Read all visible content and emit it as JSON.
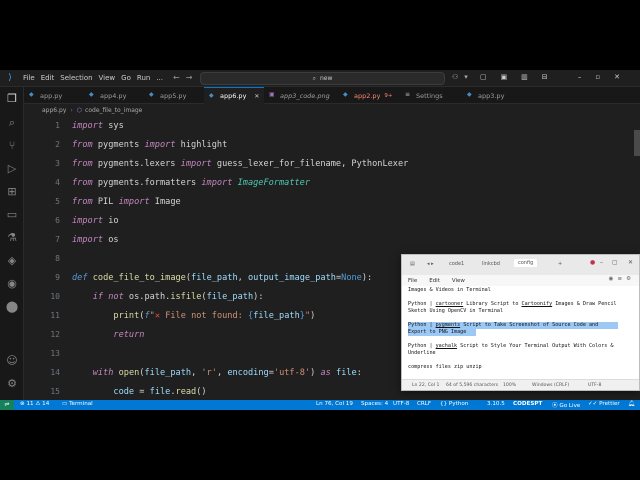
{
  "titlebar": {
    "menu": [
      "File",
      "Edit",
      "Selection",
      "View",
      "Go",
      "Run",
      "..."
    ],
    "search_text": "new"
  },
  "tabs": [
    {
      "label": "app.py"
    },
    {
      "label": "app4.py"
    },
    {
      "label": "app5.py"
    },
    {
      "label": "app6.py",
      "active": true
    },
    {
      "label": "app3_code.png"
    },
    {
      "label": "app2.py",
      "badge": "9+"
    },
    {
      "label": "Settings"
    },
    {
      "label": "app3.py"
    }
  ],
  "breadcrumb": {
    "file": "app6.py",
    "symbol": "code_file_to_image"
  },
  "editor": {
    "line_numbers": [
      "1",
      "2",
      "3",
      "4",
      "5",
      "6",
      "7",
      "8",
      "9",
      "10",
      "11",
      "12",
      "13",
      "14",
      "15"
    ]
  },
  "statusbar": {
    "errors": "11",
    "warnings": "14",
    "terminal": "Terminal",
    "position": "Ln 76, Col 19",
    "spaces": "Spaces: 4",
    "encoding": "UTF-8",
    "eol": "CRLF",
    "language": "Python",
    "version": "3.10.5",
    "brand": "CODESPT",
    "golive": "Go Live",
    "prettier": "Prettier"
  },
  "notepad": {
    "tabs": [
      "code1",
      "linkcbd",
      "config"
    ],
    "menu": [
      "File",
      "Edit",
      "View"
    ],
    "lines": {
      "l1": "Images & Videos in Terminal",
      "l2a": "Python | ",
      "l2b": "cartooner",
      "l2c": " Library Script to ",
      "l2d": "Cartoonify",
      "l2e": " Images & Draw Pencil",
      "l3": "Sketch Using OpenCV in Terminal",
      "l4a": "Python | ",
      "l4b": "pygments",
      "l4c": " Script to Take Screenshot of Source Code and",
      "l5": "Export to PNG Image",
      "l6a": "Python | ",
      "l6b": "yachalk",
      "l6c": " Script to Style Your Terminal Output With Colors &",
      "l7": "Underline",
      "l8": "compress files zip unzip"
    },
    "status": {
      "pos": "Ln 22, Col 1",
      "chars": "64 of 5,596 characters",
      "zoom": "100%",
      "eol": "Windows (CRLF)",
      "enc": "UTF-8"
    }
  }
}
